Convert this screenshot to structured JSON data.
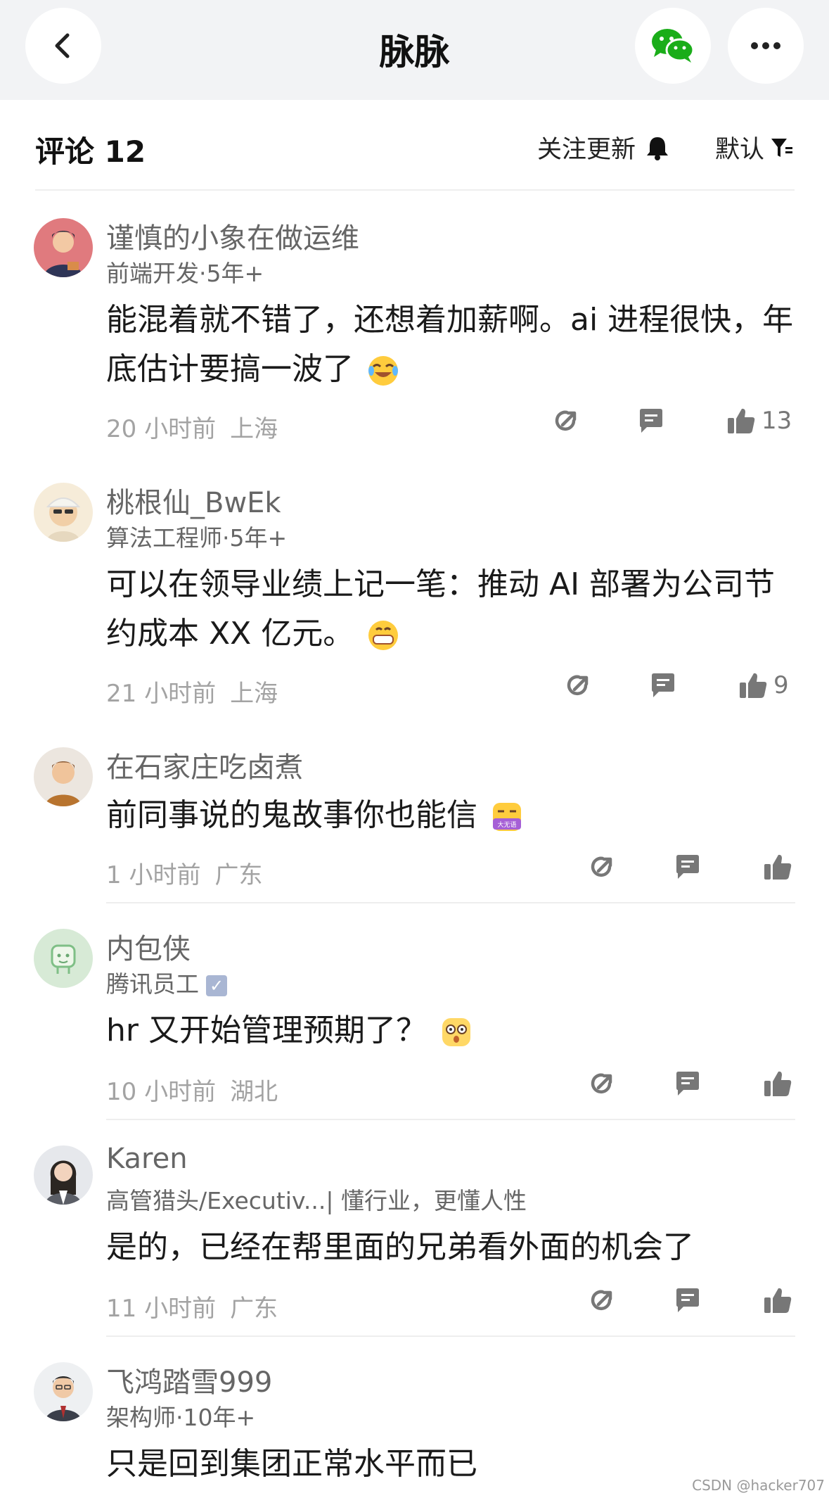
{
  "header": {
    "title": "脉脉",
    "back_icon": "chevron-left-icon",
    "share_icon": "wechat-icon",
    "more_icon": "more-horizontal-icon"
  },
  "comments_bar": {
    "label": "评论 12",
    "follow_label": "关注更新",
    "sort_label": "默认"
  },
  "comments": [
    {
      "name": "谨慎的小象在做运维",
      "subtitle": "前端开发·5年+",
      "text": "能混着就不错了，还想着加薪啊。ai 进程很快，年底估计要搞一波了",
      "time": "20 小时前",
      "location": "上海",
      "likes": "13"
    },
    {
      "name": "桃根仙_BwEk",
      "subtitle": "算法工程师·5年+",
      "text": "可以在领导业绩上记一笔：推动 AI 部署为公司节约成本 XX 亿元。",
      "time": "21 小时前",
      "location": "上海",
      "likes": "9"
    },
    {
      "name": "在石家庄吃卤煮",
      "subtitle": "",
      "text": "前同事说的鬼故事你也能信",
      "time": "1 小时前",
      "location": "广东",
      "likes": ""
    },
    {
      "name": "内包侠",
      "subtitle": "腾讯员工",
      "text": "hr 又开始管理预期了？",
      "time": "10 小时前",
      "location": "湖北",
      "likes": ""
    },
    {
      "name": "Karen",
      "subtitle": "高管猎头/Executiv...| 懂行业，更懂人性",
      "text": "是的，已经在帮里面的兄弟看外面的机会了",
      "time": "11 小时前",
      "location": "广东",
      "likes": ""
    },
    {
      "name": "飞鸿踏雪999",
      "subtitle": "架构师·10年+",
      "text": "只是回到集团正常水平而已",
      "time": "",
      "location": "",
      "likes": ""
    }
  ],
  "emoji_badge": "大无语",
  "watermark": "CSDN @hacker707",
  "colors": {
    "accent_green": "#1aad19",
    "topbar_bg": "#f2f3f5"
  }
}
